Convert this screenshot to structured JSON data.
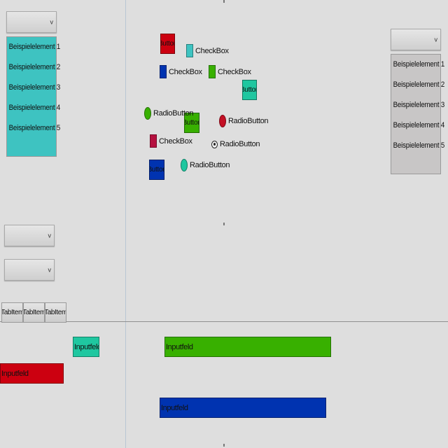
{
  "colors": {
    "teal": "#3ec3c1",
    "mint": "#1fc7a0",
    "red": "#cc0010",
    "crimson": "#b5103f",
    "green": "#38b000",
    "blue": "#0033b0",
    "grey_list": "#c8c6c6"
  },
  "left_dropdown": {
    "value": "",
    "icon": "chevron-down-icon",
    "chevron": "v"
  },
  "left_list": {
    "items": [
      "Beispielelement 1",
      "Beispielelement 2",
      "Beispielelement 3",
      "Beispielelement 4",
      "Beispielelement 5"
    ]
  },
  "right_dropdown": {
    "value": "",
    "icon": "chevron-down-icon",
    "chevron": "v"
  },
  "right_list": {
    "items": [
      "Beispielelement 1",
      "Beispielelement 2",
      "Beispielelement 3",
      "Beispielelement 4",
      "Beispielelement 5"
    ]
  },
  "mid_dropdowns": [
    {
      "value": "",
      "chevron": "v"
    },
    {
      "value": "",
      "chevron": "v"
    }
  ],
  "controls": {
    "button_red": "Button",
    "button_mint": "Button",
    "button_green": "Button",
    "button_blue": "Button",
    "checkbox_teal": "CheckBox",
    "checkbox_blue": "CheckBox",
    "checkbox_green": "CheckBox",
    "checkbox_crimson": "CheckBox",
    "radio_green": "RadioButton",
    "radio_red": "RadioButton",
    "radio_selected": "RadioButton",
    "radio_teal": "RadioButton"
  },
  "tabs": [
    "TabItem",
    "TabItem",
    "TabItem"
  ],
  "inputs": {
    "mint": "Inputfeld",
    "red": "Inputfeld",
    "green": "Inputfeld",
    "blue": "Inputfeld"
  }
}
